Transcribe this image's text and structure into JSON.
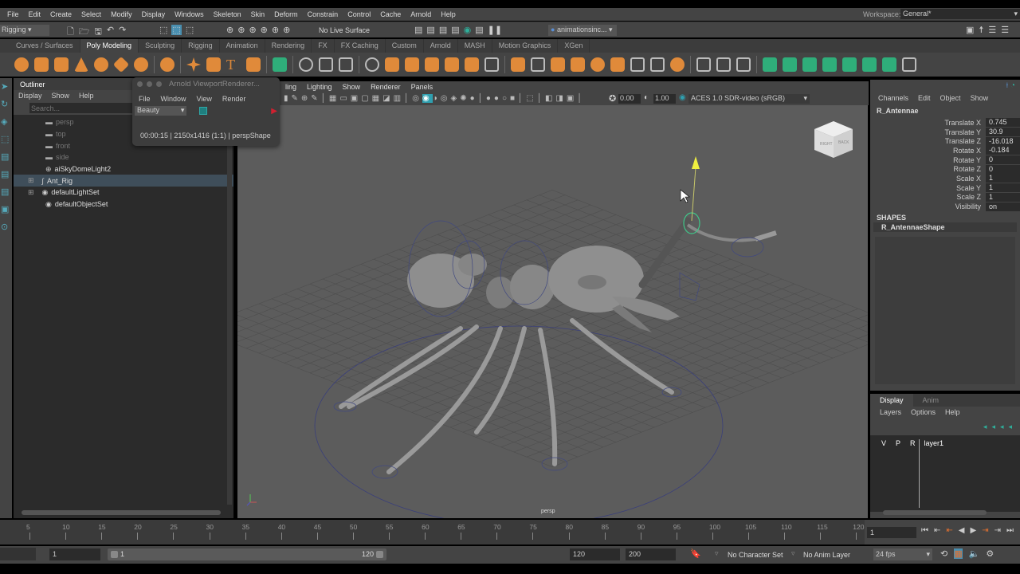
{
  "menubar": [
    "File",
    "Edit",
    "Create",
    "Select",
    "Modify",
    "Display",
    "Windows",
    "Skeleton",
    "Skin",
    "Deform",
    "Constrain",
    "Control",
    "Cache",
    "Arnold",
    "Help"
  ],
  "workspace": {
    "label": "Workspace:",
    "value": "General*"
  },
  "status": {
    "mode": "Rigging",
    "live_surface": "No Live Surface",
    "user": "animationsinc..."
  },
  "shelf_tabs": [
    "Curves / Surfaces",
    "Poly Modeling",
    "Sculpting",
    "Rigging",
    "Animation",
    "Rendering",
    "FX",
    "FX Caching",
    "Custom",
    "Arnold",
    "MASH",
    "Motion Graphics",
    "XGen"
  ],
  "shelf_active": "Poly Modeling",
  "outliner": {
    "title": "Outliner",
    "menu": [
      "Display",
      "Show",
      "Help"
    ],
    "search_placeholder": "Search...",
    "items": [
      {
        "label": "persp",
        "icon": "camera-icon"
      },
      {
        "label": "top",
        "icon": "camera-icon"
      },
      {
        "label": "front",
        "icon": "camera-icon"
      },
      {
        "label": "side",
        "icon": "camera-icon"
      },
      {
        "label": "aiSkyDomeLight2",
        "icon": "light-icon"
      },
      {
        "label": "Ant_Rig",
        "icon": "curve-icon"
      },
      {
        "label": "defaultLightSet",
        "icon": "set-icon"
      },
      {
        "label": "defaultObjectSet",
        "icon": "set-icon"
      }
    ]
  },
  "arnold": {
    "title": "Arnold ViewportRenderer...",
    "menu": [
      "File",
      "Window",
      "View",
      "Render"
    ],
    "aov": "Beauty",
    "info": "00:00:15 | 2150x1416 (1:1) | perspShape"
  },
  "viewport": {
    "menu": [
      "ling",
      "Lighting",
      "Show",
      "Renderer",
      "Panels"
    ],
    "exposure": "0.00",
    "gamma": "1.00",
    "colorspace": "ACES 1.0 SDR-video (sRGB)",
    "camera": "persp",
    "cube_right": "RIGHT",
    "cube_back": "BACK"
  },
  "channelbox": {
    "menu": [
      "Channels",
      "Edit",
      "Object",
      "Show"
    ],
    "object": "R_Antennae",
    "channels": [
      {
        "label": "Translate X",
        "value": "0.745"
      },
      {
        "label": "Translate Y",
        "value": "30.9"
      },
      {
        "label": "Translate Z",
        "value": "-16.018"
      },
      {
        "label": "Rotate X",
        "value": "-0.184"
      },
      {
        "label": "Rotate Y",
        "value": "0"
      },
      {
        "label": "Rotate Z",
        "value": "0"
      },
      {
        "label": "Scale X",
        "value": "1"
      },
      {
        "label": "Scale Y",
        "value": "1"
      },
      {
        "label": "Scale Z",
        "value": "1"
      },
      {
        "label": "Visibility",
        "value": "on"
      }
    ],
    "shapes_label": "SHAPES",
    "shape": "R_AntennaeShape"
  },
  "layers": {
    "tabs": [
      "Display",
      "Anim"
    ],
    "menu": [
      "Layers",
      "Options",
      "Help"
    ],
    "row": {
      "v": "V",
      "p": "P",
      "r": "R",
      "name": "layer1"
    }
  },
  "timeline": {
    "ticks": [
      "5",
      "10",
      "15",
      "20",
      "25",
      "30",
      "35",
      "40",
      "45",
      "50",
      "55",
      "60",
      "65",
      "70",
      "75",
      "80",
      "85",
      "90",
      "95",
      "100",
      "105",
      "110",
      "115",
      "120"
    ],
    "current": "1"
  },
  "range": {
    "start": "1",
    "inner_start": "1",
    "inner_end": "120",
    "end": "120",
    "max": "200",
    "character_set": "No Character Set",
    "anim_layer": "No Anim Layer",
    "fps": "24 fps"
  }
}
